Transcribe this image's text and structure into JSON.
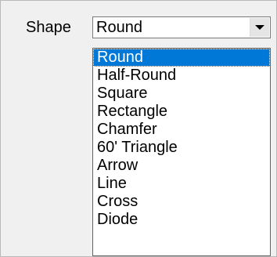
{
  "shape_field": {
    "label": "Shape",
    "selected_value": "Round",
    "options": [
      "Round",
      "Half-Round",
      "Square",
      "Rectangle",
      "Chamfer",
      "60' Triangle",
      "Arrow",
      "Line",
      "Cross",
      "Diode"
    ],
    "highlighted_option": "Round"
  },
  "icons": {
    "dropdown_arrow": "chevron-down-icon"
  },
  "colors": {
    "selection_highlight": "#0078d7",
    "panel_background": "#f0f0f0"
  }
}
